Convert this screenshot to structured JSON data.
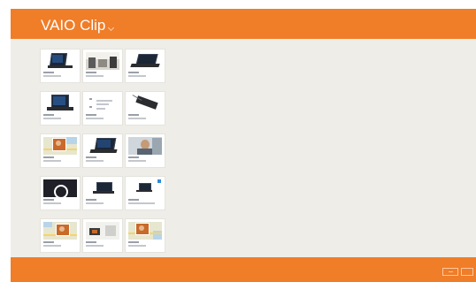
{
  "app": {
    "title": "VAIO Clip",
    "title_menu_icon": "chevron-down-icon"
  },
  "colors": {
    "accent": "#f07d28",
    "background": "#eeede8",
    "tile": "#ffffff"
  },
  "clips": [
    {
      "thumbnail": "laptop-tablet-mode"
    },
    {
      "thumbnail": "office-room-photo"
    },
    {
      "thumbnail": "laptop-open-angled"
    },
    {
      "thumbnail": "laptop-open-front"
    },
    {
      "thumbnail": "text-document"
    },
    {
      "thumbnail": "tablet-stylus"
    },
    {
      "thumbnail": "map-with-photo"
    },
    {
      "thumbnail": "laptop-open-blue-screen"
    },
    {
      "thumbnail": "person-in-car"
    },
    {
      "thumbnail": "ring-on-dark-screen"
    },
    {
      "thumbnail": "laptop-on-table"
    },
    {
      "thumbnail": "laptop-product-page"
    },
    {
      "thumbnail": "map-with-photo"
    },
    {
      "thumbnail": "product-photo-on-map"
    },
    {
      "thumbnail": "map-with-photo"
    }
  ],
  "app_bar": {
    "buttons": [
      {
        "icon": "minimize-icon"
      },
      {
        "icon": "close-icon"
      }
    ]
  }
}
